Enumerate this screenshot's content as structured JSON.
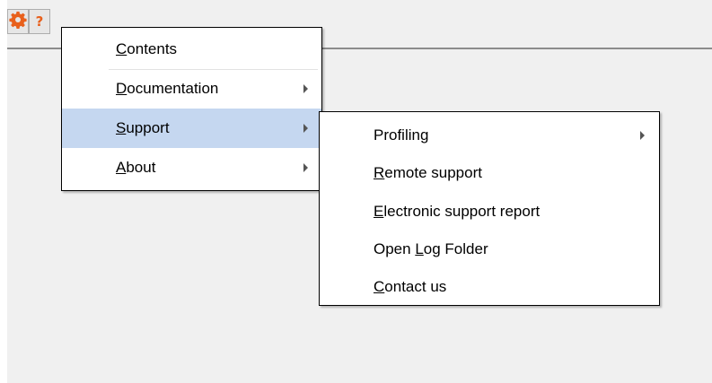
{
  "toolbar": {
    "buttons": [
      {
        "icon": "gear-icon",
        "color": "#e8601c"
      },
      {
        "icon": "help-icon",
        "glyph": "?",
        "color": "#e8601c"
      }
    ]
  },
  "main_menu": {
    "items": [
      {
        "mnemonic": "C",
        "rest": "ontents",
        "has_submenu": false,
        "highlighted": false
      },
      {
        "mnemonic": "D",
        "rest": "ocumentation",
        "has_submenu": true,
        "highlighted": false
      },
      {
        "mnemonic": "S",
        "rest": "upport",
        "has_submenu": true,
        "highlighted": true
      },
      {
        "mnemonic": "A",
        "rest": "bout",
        "has_submenu": true,
        "highlighted": false
      }
    ],
    "highlight_color": "#c5d7f0"
  },
  "support_submenu": {
    "items": [
      {
        "before": "Profiling",
        "mnemonic": "",
        "rest": "",
        "has_submenu": true
      },
      {
        "before": "",
        "mnemonic": "R",
        "rest": "emote support",
        "has_submenu": false
      },
      {
        "before": "",
        "mnemonic": "E",
        "rest": "lectronic support report",
        "has_submenu": false
      },
      {
        "before": "Open ",
        "mnemonic": "L",
        "rest": "og Folder",
        "has_submenu": false
      },
      {
        "before": "",
        "mnemonic": "C",
        "rest": "ontact us",
        "has_submenu": false
      }
    ]
  }
}
